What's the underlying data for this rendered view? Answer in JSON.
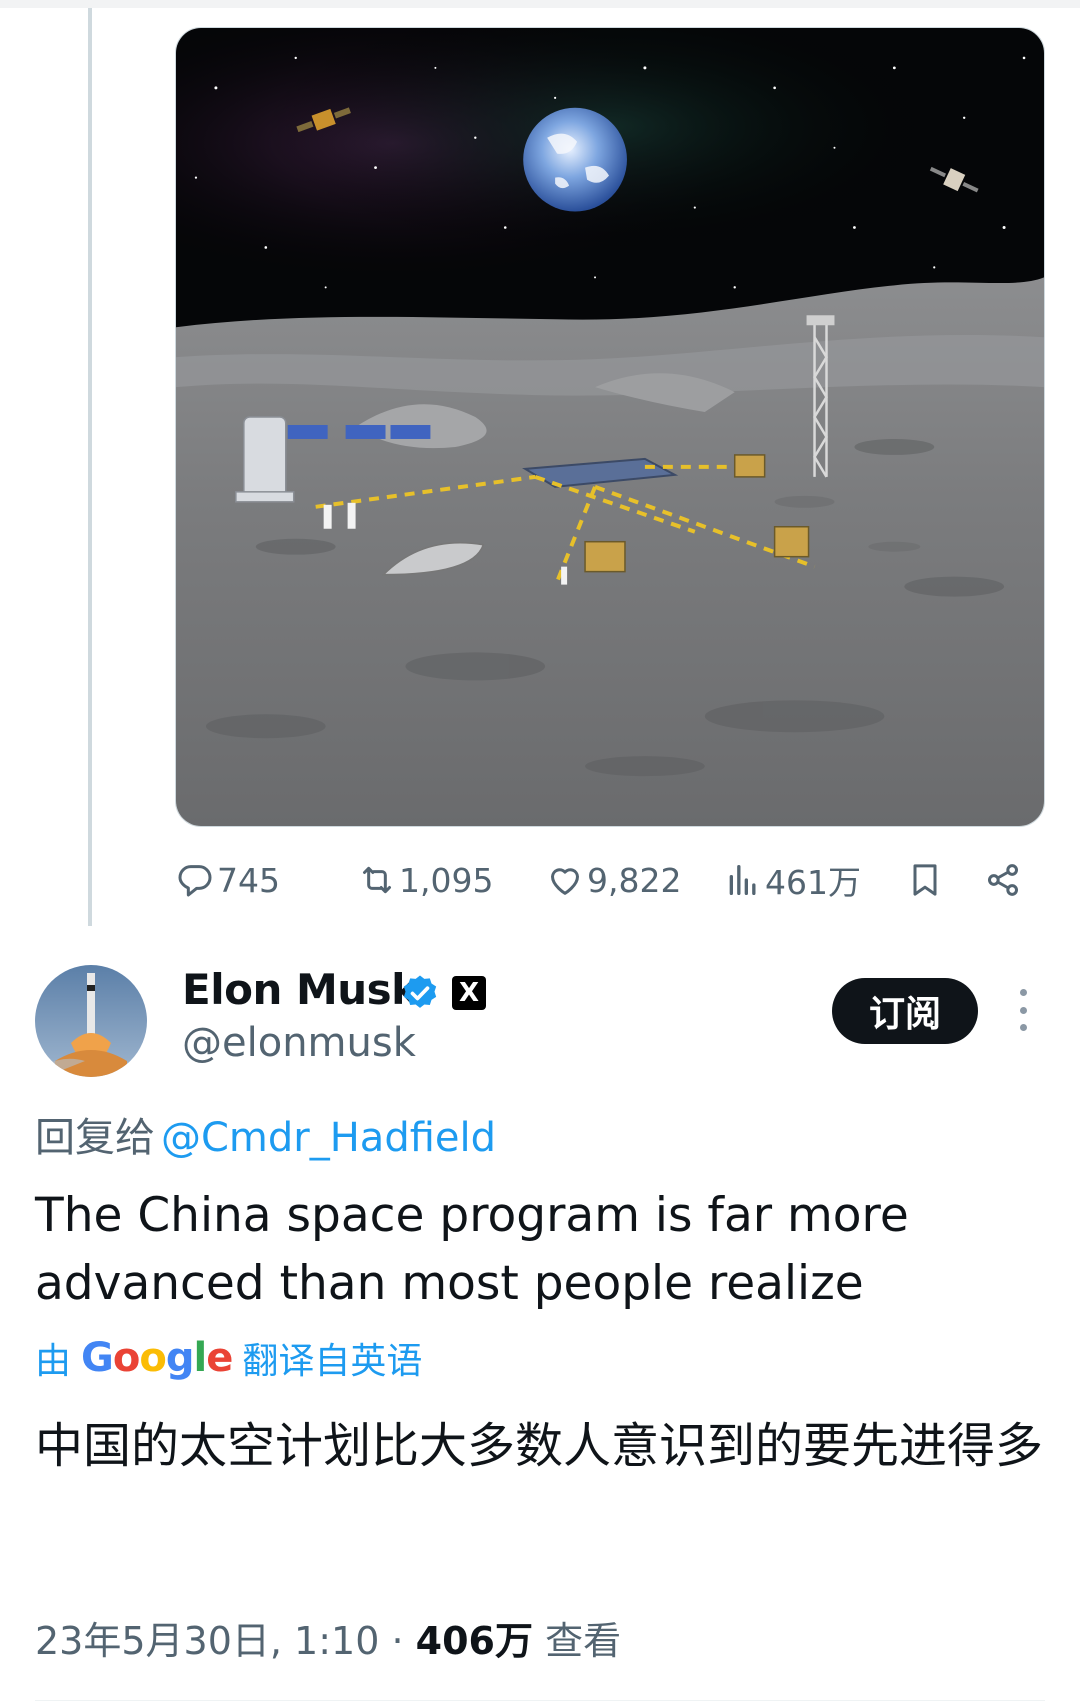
{
  "tweet_actions": {
    "replies": "745",
    "retweets": "1,095",
    "likes": "9,822",
    "views": "461万"
  },
  "author": {
    "name": "Elon Musk",
    "handle": "@elonmusk",
    "badge_letter": "X",
    "verified_color": "#1d9bf0"
  },
  "subscribe_label": "订阅",
  "reply_to": {
    "prefix": "回复给",
    "mention": "@Cmdr_Hadfield"
  },
  "tweet_text": "The China space program is far more advanced than most people realize",
  "translation": {
    "prefix": "由",
    "google": [
      "G",
      "o",
      "o",
      "g",
      "l",
      "e"
    ],
    "suffix": "翻译自英语",
    "text": "中国的太空计划比大多数人意识到的要先进得多"
  },
  "meta": {
    "timestamp": "23年5月30日, 1:10",
    "separator": " · ",
    "views_count": "406万",
    "views_label": "查看"
  },
  "icons": {
    "reply": "reply-icon",
    "retweet": "retweet-icon",
    "like": "heart-icon",
    "views": "bar-chart-icon",
    "bookmark": "bookmark-icon",
    "share": "share-icon",
    "more": "more-dots-icon",
    "verified": "verified-badge-icon"
  },
  "colors": {
    "accent": "#1d9bf0",
    "text": "#0f1419",
    "secondary": "#536471"
  }
}
